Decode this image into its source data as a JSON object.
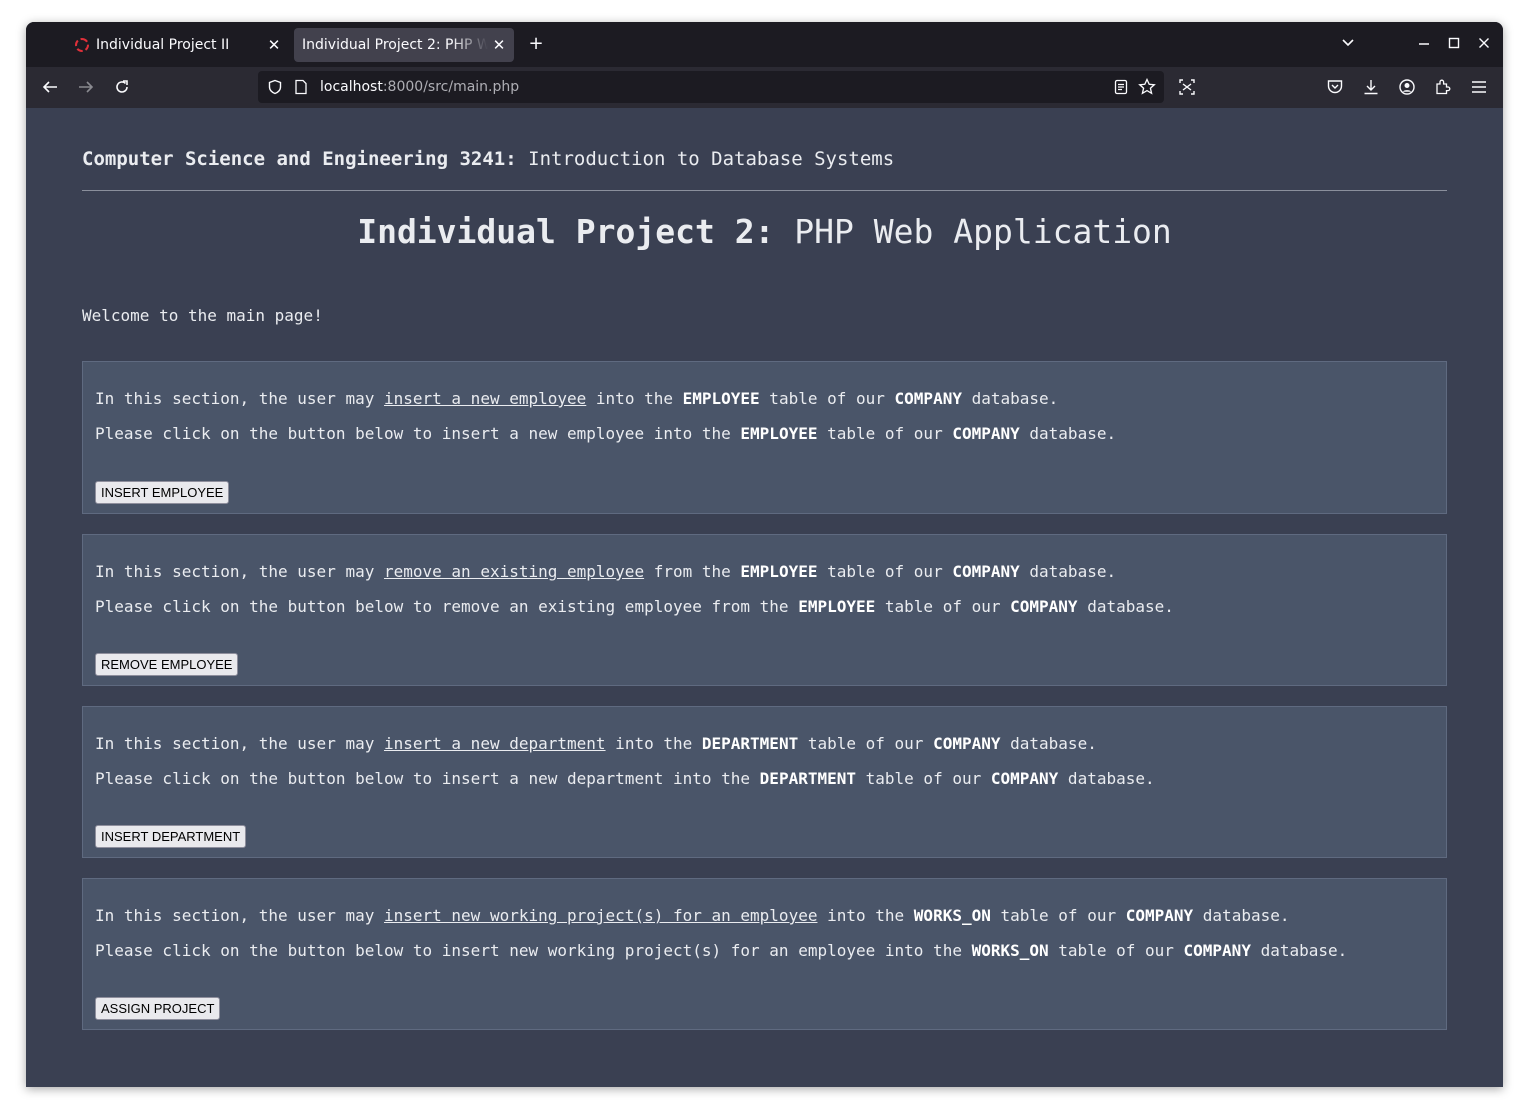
{
  "browser": {
    "tabs": [
      {
        "title": "Individual Project II",
        "active": false
      },
      {
        "title": "Individual Project 2: PHP Web Application",
        "active": true
      }
    ],
    "new_tab_label": "+",
    "url_host": "localhost",
    "url_path": ":8000/src/main.php"
  },
  "page": {
    "course_bold": "Computer Science and Engineering 3241:",
    "course_rest": " Introduction to Database Systems",
    "title_bold": "Individual Project 2:",
    "title_rest": " PHP Web Application",
    "welcome": "Welcome to the main page!"
  },
  "sections": [
    {
      "l1_a": "In this section, the user may ",
      "l1_link": "insert a new employee",
      "l1_b": " into the ",
      "l1_table": "EMPLOYEE",
      "l1_c": " table of our ",
      "l1_db": "COMPANY",
      "l1_d": " database.",
      "l2_a": "Please click on the button below to insert a new employee into the ",
      "l2_table": "EMPLOYEE",
      "l2_b": " table of our ",
      "l2_db": "COMPANY",
      "l2_c": " database.",
      "button": "INSERT EMPLOYEE"
    },
    {
      "l1_a": "In this section, the user may ",
      "l1_link": "remove an existing employee",
      "l1_b": " from the ",
      "l1_table": "EMPLOYEE",
      "l1_c": " table of our ",
      "l1_db": "COMPANY",
      "l1_d": " database.",
      "l2_a": "Please click on the button below to remove an existing employee from the ",
      "l2_table": "EMPLOYEE",
      "l2_b": " table of our ",
      "l2_db": "COMPANY",
      "l2_c": " database.",
      "button": "REMOVE EMPLOYEE"
    },
    {
      "l1_a": "In this section, the user may ",
      "l1_link": "insert a new department",
      "l1_b": " into the ",
      "l1_table": "DEPARTMENT",
      "l1_c": " table of our ",
      "l1_db": "COMPANY",
      "l1_d": " database.",
      "l2_a": "Please click on the button below to insert a new department into the ",
      "l2_table": "DEPARTMENT",
      "l2_b": " table of our ",
      "l2_db": "COMPANY",
      "l2_c": " database.",
      "button": "INSERT DEPARTMENT"
    },
    {
      "l1_a": "In this section, the user may ",
      "l1_link": "insert new working project(s) for an employee",
      "l1_b": " into the ",
      "l1_table": "WORKS_ON",
      "l1_c": " table of our ",
      "l1_db": "COMPANY",
      "l1_d": " database.",
      "l2_a": "Please click on the button below to insert new working project(s) for an employee into the ",
      "l2_table": "WORKS_ON",
      "l2_b": " table of our ",
      "l2_db": "COMPANY",
      "l2_c": " database.",
      "button": "ASSIGN PROJECT"
    }
  ],
  "colors": {
    "page_bg": "#3a4052",
    "section_bg": "#4a5569",
    "tabbar_bg": "#1c1b22",
    "navbar_bg": "#2b2a33"
  }
}
